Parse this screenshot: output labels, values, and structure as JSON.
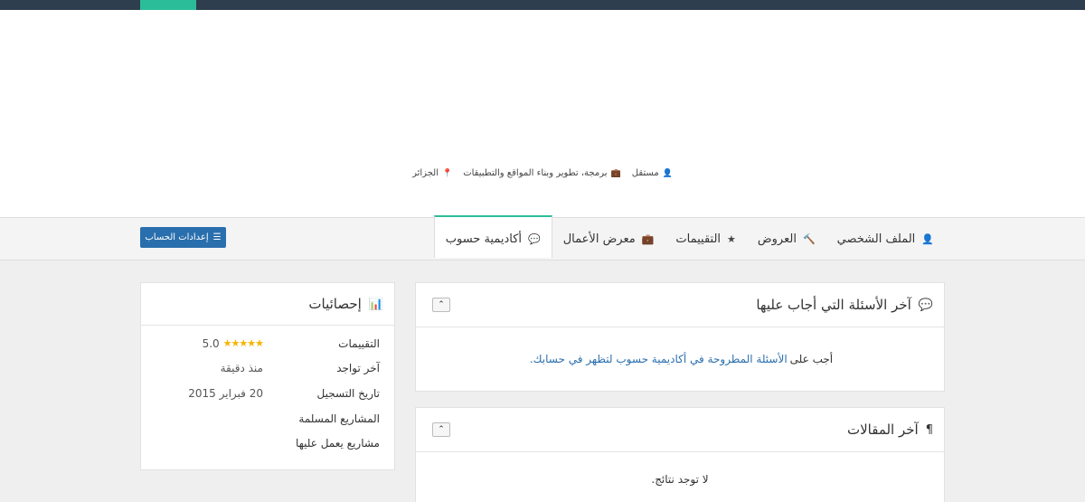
{
  "header": {
    "meta": {
      "role": "مستقل",
      "specialty": "برمجة، تطوير وبناء المواقع والتطبيقات",
      "location": "الجزائر"
    }
  },
  "tabs": [
    {
      "label": "الملف الشخصي",
      "icon": "user-icon"
    },
    {
      "label": "العروض",
      "icon": "gavel-icon"
    },
    {
      "label": "التقييمات",
      "icon": "star-icon"
    },
    {
      "label": "معرض الأعمال",
      "icon": "briefcase-icon"
    },
    {
      "label": "أكاديمية حسوب",
      "icon": "comments-icon",
      "active": true
    }
  ],
  "settings_button": {
    "label": "إعدادات الحساب",
    "icon": "sliders-icon"
  },
  "questions_panel": {
    "title": "آخر الأسئلة التي أجاب عليها",
    "text_before": "أجب على",
    "link_text": "الأسئلة المطروحة في أكاديمية حسوب لتظهر في حسابك."
  },
  "articles_panel": {
    "title": "آخر المقالات",
    "empty_text": "لا توجد نتائج."
  },
  "stats_panel": {
    "title": "إحصائيات",
    "rows": [
      {
        "label": "التقييمات",
        "value": "5.0",
        "stars": 5
      },
      {
        "label": "آخر تواجد",
        "value": "منذ دقيقة"
      },
      {
        "label": "تاريخ التسجيل",
        "value": "20 فبراير 2015"
      },
      {
        "label": "المشاريع المسلمة",
        "value": ""
      },
      {
        "label": "مشاريع يعمل عليها",
        "value": ""
      }
    ]
  },
  "colors": {
    "topbar": "#2e3e4f",
    "accent": "#2bbd9a",
    "primary_button": "#2a6fad",
    "link": "#2a6fad",
    "star": "#f4b400"
  }
}
